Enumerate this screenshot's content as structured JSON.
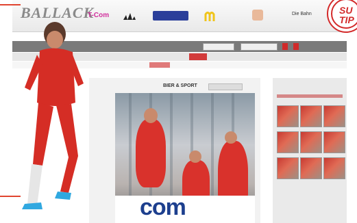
{
  "header": {
    "logo": "BALLACK",
    "sponsors": [
      {
        "name": "T-Com",
        "icon": "tcom-logo",
        "color": "#d12f9c"
      },
      {
        "name": "adidas",
        "icon": "adidas-logo"
      },
      {
        "name": "PlayStation",
        "icon": "playstation-logo",
        "color": "#2b3f9a"
      },
      {
        "name": "McDonald's",
        "icon": "mcdonalds-logo",
        "color": "#f0c419"
      },
      {
        "name": "sponsor-5",
        "icon": "sponsor-logo"
      },
      {
        "name": "Die Bahn",
        "icon": "diebahn-logo"
      }
    ]
  },
  "badge": {
    "text": "SU TIP"
  },
  "content": {
    "title": "BIER & SPORT",
    "ad_text": "com"
  },
  "colors": {
    "accent_red": "#d32a2a",
    "nav_dark": "#7a7a7a"
  }
}
